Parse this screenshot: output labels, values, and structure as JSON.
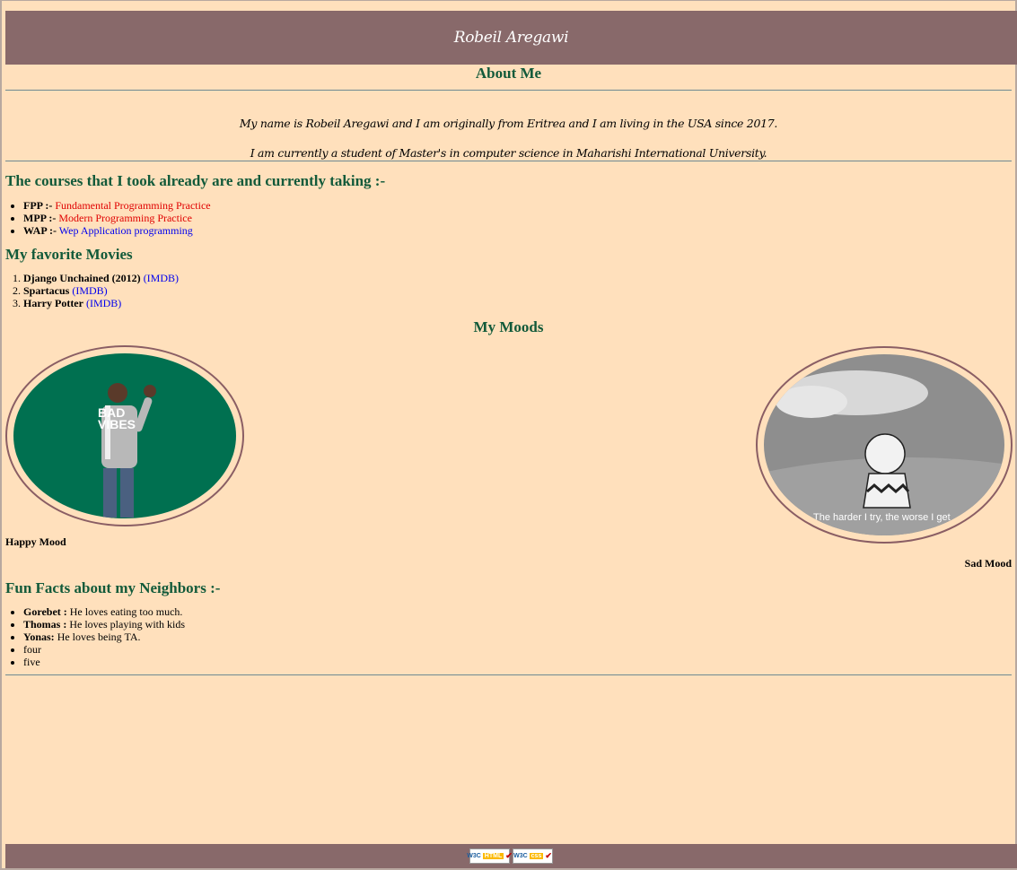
{
  "header": {
    "title": "Robeil Aregawi"
  },
  "about": {
    "title": "About Me",
    "p1": "My name is Robeil Aregawi and I am originally from Eritrea and I am living in the USA since 2017.",
    "p2": "I am currently a student of Master's in computer science in Maharishi International University."
  },
  "courses": {
    "title": "The courses that I took already are and currently taking :-",
    "items": [
      {
        "code": "FPP :-",
        "name": "Fundamental Programming Practice"
      },
      {
        "code": "MPP :-",
        "name": "Modern Programming Practice"
      },
      {
        "code": "WAP :-",
        "name": "Wep Application programming"
      }
    ]
  },
  "movies": {
    "title": "My favorite Movies",
    "items": [
      {
        "name": "Django Unchained (2012)",
        "link": "(IMDB)"
      },
      {
        "name": "Spartacus",
        "link": "(IMDB)"
      },
      {
        "name": "Harry Potter",
        "link": "(IMDB)"
      }
    ]
  },
  "moods": {
    "title": "My Moods",
    "happy": {
      "label": "Happy Mood",
      "image_text": "BAD\nVIBES"
    },
    "sad": {
      "label": "Sad Mood",
      "image_caption": "The harder I try, the worse I get"
    }
  },
  "facts": {
    "title": "Fun Facts about my Neighbors :-",
    "items": [
      {
        "name": "Gorebet :",
        "fact": "He loves eating too much."
      },
      {
        "name": "Thomas :",
        "fact": "He loves playing with kids"
      },
      {
        "name": "Yonas:",
        "fact": "He loves being TA."
      },
      {
        "name": "",
        "fact": "four"
      },
      {
        "name": "",
        "fact": "five"
      }
    ]
  },
  "footer": {
    "badges": [
      {
        "org": "W3C",
        "kind": "HTML"
      },
      {
        "org": "W3C",
        "kind": "css"
      }
    ]
  },
  "colors": {
    "header_bg": "#88696a",
    "page_bg": "#ffe0bc",
    "heading": "#125a3a",
    "course_link": "#e00000",
    "link": "#0000ee"
  }
}
